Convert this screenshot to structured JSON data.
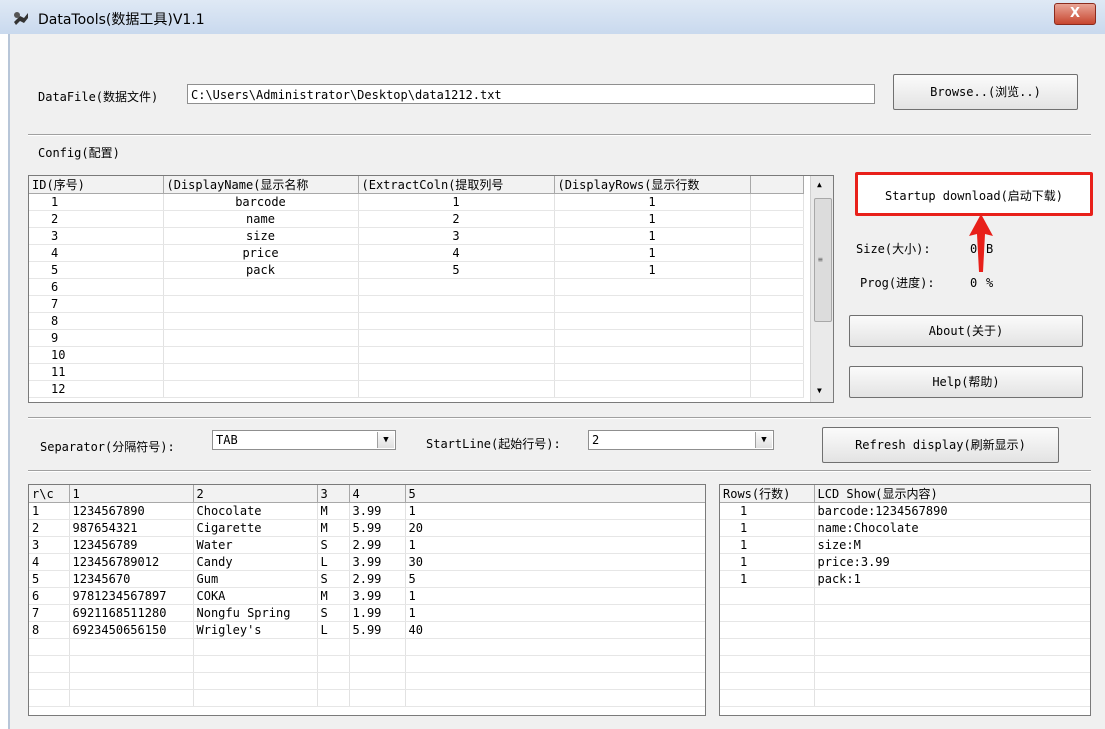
{
  "window": {
    "title": "DataTools(数据工具)V1.1",
    "close_label": "X"
  },
  "datafile": {
    "label": "DataFile(数据文件)",
    "value": "C:\\Users\\Administrator\\Desktop\\data1212.txt",
    "browse_label": "Browse..(浏览..)"
  },
  "config": {
    "section_label": "Config(配置)",
    "columns": [
      "ID(序号)",
      "(DisplayName(显示名称",
      "(ExtractColn(提取列号",
      "(DisplayRows(显示行数"
    ],
    "rows": [
      [
        "1",
        "barcode",
        "1",
        "1"
      ],
      [
        "2",
        "name",
        "2",
        "1"
      ],
      [
        "3",
        "size",
        "3",
        "1"
      ],
      [
        "4",
        "price",
        "4",
        "1"
      ],
      [
        "5",
        "pack",
        "5",
        "1"
      ],
      [
        "6",
        "",
        "",
        ""
      ],
      [
        "7",
        "",
        "",
        ""
      ],
      [
        "8",
        "",
        "",
        ""
      ],
      [
        "9",
        "",
        "",
        ""
      ],
      [
        "10",
        "",
        "",
        ""
      ],
      [
        "11",
        "",
        "",
        ""
      ],
      [
        "12",
        "",
        "",
        ""
      ]
    ]
  },
  "side": {
    "startup_label": "Startup download(启动下载)",
    "size_label": "Size(大小):",
    "size_value": "0",
    "size_unit": "B",
    "prog_label": "Prog(进度):",
    "prog_value": "0",
    "prog_unit": "%",
    "about_label": "About(关于)",
    "help_label": "Help(帮助)",
    "highlight_color": "#e8201a"
  },
  "options": {
    "separator_label": "Separator(分隔符号):",
    "separator_value": "TAB",
    "startline_label": "StartLine(起始行号):",
    "startline_value": "2",
    "refresh_label": "Refresh display(刷新显示)"
  },
  "data_table": {
    "columns": [
      "r\\c",
      "1",
      "2",
      "3",
      "4",
      "5"
    ],
    "rows": [
      [
        "1",
        "1234567890",
        "Chocolate",
        "M",
        "3.99",
        "1"
      ],
      [
        "2",
        "987654321",
        "Cigarette",
        "M",
        "5.99",
        "20"
      ],
      [
        "3",
        "123456789",
        "Water",
        "S",
        "2.99",
        "1"
      ],
      [
        "4",
        "123456789012",
        "Candy",
        "L",
        "3.99",
        "30"
      ],
      [
        "5",
        "12345670",
        "Gum",
        "S",
        "2.99",
        "5"
      ],
      [
        "6",
        "9781234567897",
        "COKA",
        "M",
        "3.99",
        "1"
      ],
      [
        "7",
        "6921168511280",
        "Nongfu Spring",
        "S",
        "1.99",
        "1"
      ],
      [
        "8",
        "6923450656150",
        "Wrigley's",
        "L",
        "5.99",
        "40"
      ]
    ]
  },
  "lcd_table": {
    "columns": [
      "Rows(行数)",
      "LCD Show(显示内容)"
    ],
    "rows": [
      [
        "1",
        "barcode:1234567890"
      ],
      [
        "1",
        "name:Chocolate"
      ],
      [
        "1",
        "size:M"
      ],
      [
        "1",
        "price:3.99"
      ],
      [
        "1",
        "pack:1"
      ]
    ]
  }
}
